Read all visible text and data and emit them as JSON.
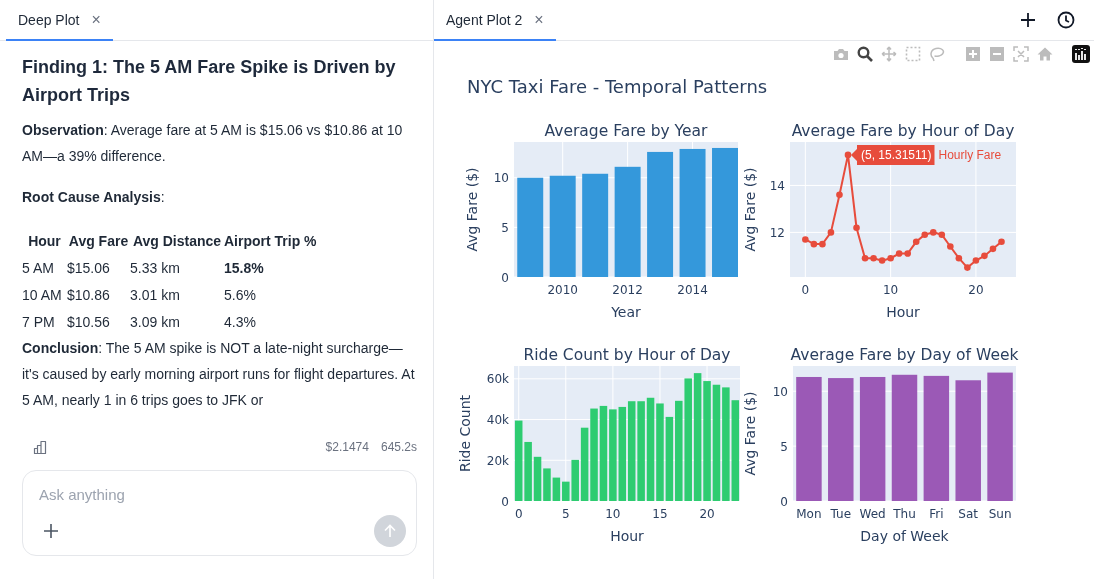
{
  "left_panel": {
    "tab": {
      "label": "Deep Plot",
      "close": "×",
      "selected": true
    },
    "message": {
      "heading": "Finding 1: The 5 AM Fare Spike is Driven by Airport Trips",
      "observation": "**Observation**: Average fare at 5 AM is $15.06 vs $10.86 at 10 AM—a 39% difference.",
      "analysis_label": "**Root Cause Analysis**:",
      "table": {
        "columns": [
          "Hour",
          "Avg Fare",
          "Avg Distance",
          "Airport Trip %"
        ],
        "rows": [
          [
            "5 AM",
            "$15.06",
            "5.33 km",
            "**15.8%**"
          ],
          [
            "10 AM",
            "$10.86",
            "3.01 km",
            "5.6%"
          ],
          [
            "7 PM",
            "$10.56",
            "3.09 km",
            "4.3%"
          ]
        ]
      },
      "conclusion": "**Conclusion**: The 5 AM spike is NOT a late-night surcharge—it's caused by early morning airport runs for flight departures. At 5 AM, nearly 1 in 6 trips goes to JFK or"
    },
    "footer": {
      "cost": "$2.1474",
      "duration": "645.2s"
    },
    "composer": {
      "placeholder": "Ask anything",
      "send_disabled": true
    }
  },
  "right_panel": {
    "tab": {
      "label": "Agent Plot 2",
      "close": "×",
      "selected": true
    },
    "modebar": [
      {
        "kind": "camera",
        "selected": false
      },
      {
        "kind": "zoom",
        "selected": true
      },
      {
        "kind": "pan",
        "selected": false
      },
      {
        "kind": "select",
        "selected": false
      },
      {
        "kind": "lasso",
        "selected": false
      },
      {
        "kind": "zoom_in",
        "selected": false
      },
      {
        "kind": "zoom_out",
        "selected": false
      },
      {
        "kind": "autoscale",
        "selected": false
      },
      {
        "kind": "home",
        "selected": false
      },
      {
        "kind": "logo"
      }
    ],
    "figure_title": "NYC Taxi Fare - Temporal Patterns",
    "subplots": [
      {
        "chart_data": {
          "type": "bar",
          "title": "Average Fare by Year",
          "xlabel": "Year",
          "ylabel": "Avg Fare ($)",
          "x": [
            2009,
            2010,
            2011,
            2012,
            2013,
            2014,
            2015
          ],
          "series": [
            {
              "color": "#3498db",
              "values": [
                10.0,
                10.2,
                10.4,
                11.1,
                12.6,
                12.9,
                13.0
              ]
            }
          ],
          "grid": true,
          "xlim": [
            2008.5,
            2015.4
          ],
          "ylim": [
            0,
            13.6
          ],
          "xticks": [
            2010,
            2012,
            2014
          ],
          "yticks": [
            0,
            5,
            10
          ]
        }
      },
      {
        "chart_data": {
          "type": "line",
          "title": "Average Fare by Hour of Day",
          "xlabel": "Hour",
          "ylabel": "Avg Fare ($)",
          "x": [
            0,
            1,
            2,
            3,
            4,
            5,
            6,
            7,
            8,
            9,
            10,
            11,
            12,
            13,
            14,
            15,
            16,
            17,
            18,
            19,
            20,
            21,
            22,
            23
          ],
          "series": [
            {
              "name": "Hourly Fare",
              "color": "#e74c3c",
              "marker": true,
              "values": [
                11.7,
                11.5,
                11.5,
                12.0,
                13.6,
                15.3,
                12.2,
                10.9,
                10.9,
                10.8,
                10.9,
                11.1,
                11.1,
                11.6,
                11.9,
                12.0,
                11.9,
                11.4,
                10.9,
                10.5,
                10.8,
                11.0,
                11.3,
                11.6
              ]
            }
          ],
          "grid": true,
          "xlim": [
            -1.8,
            24.7
          ],
          "ylim": [
            10.1,
            15.85
          ],
          "xticks": [
            0,
            10,
            20
          ],
          "yticks": [
            12,
            14
          ],
          "annotations": [
            {
              "x": 5,
              "y": 15.3,
              "text": "(5, 15.31511)"
            }
          ]
        }
      },
      {
        "chart_data": {
          "type": "bar",
          "title": "Ride Count by Hour of Day",
          "xlabel": "Hour",
          "ylabel": "Ride Count",
          "x": [
            0,
            1,
            2,
            3,
            4,
            5,
            6,
            7,
            8,
            9,
            10,
            11,
            12,
            13,
            14,
            15,
            16,
            17,
            18,
            19,
            20,
            21,
            22,
            23
          ],
          "series": [
            {
              "color": "#2ecc71",
              "values": [
                39500,
                29000,
                21700,
                16000,
                11500,
                9500,
                20200,
                36000,
                45400,
                46700,
                45000,
                46200,
                49000,
                49000,
                50700,
                47900,
                41300,
                49200,
                60200,
                62800,
                58900,
                57100,
                55800,
                49500
              ]
            }
          ],
          "grid": true,
          "xlim": [
            -0.5,
            23.5
          ],
          "ylim": [
            0,
            66300
          ],
          "xticks": [
            0,
            5,
            10,
            15,
            20
          ],
          "yticks": [
            {
              "value": 0,
              "label": "0"
            },
            {
              "value": 20000,
              "label": "20k"
            },
            {
              "value": 40000,
              "label": "40k"
            },
            {
              "value": 60000,
              "label": "60k"
            }
          ]
        }
      },
      {
        "chart_data": {
          "type": "bar",
          "title": "Average Fare by Day of Week",
          "xlabel": "Day of Week",
          "ylabel": "Avg Fare ($)",
          "categories": [
            "Mon",
            "Tue",
            "Wed",
            "Thu",
            "Fri",
            "Sat",
            "Sun"
          ],
          "series": [
            {
              "color": "#9b59b6",
              "values": [
                11.3,
                11.2,
                11.3,
                11.5,
                11.4,
                11.0,
                11.7
              ]
            }
          ],
          "grid": true,
          "ylim": [
            0,
            12.3
          ],
          "yticks": [
            0,
            5,
            10
          ]
        }
      }
    ]
  }
}
